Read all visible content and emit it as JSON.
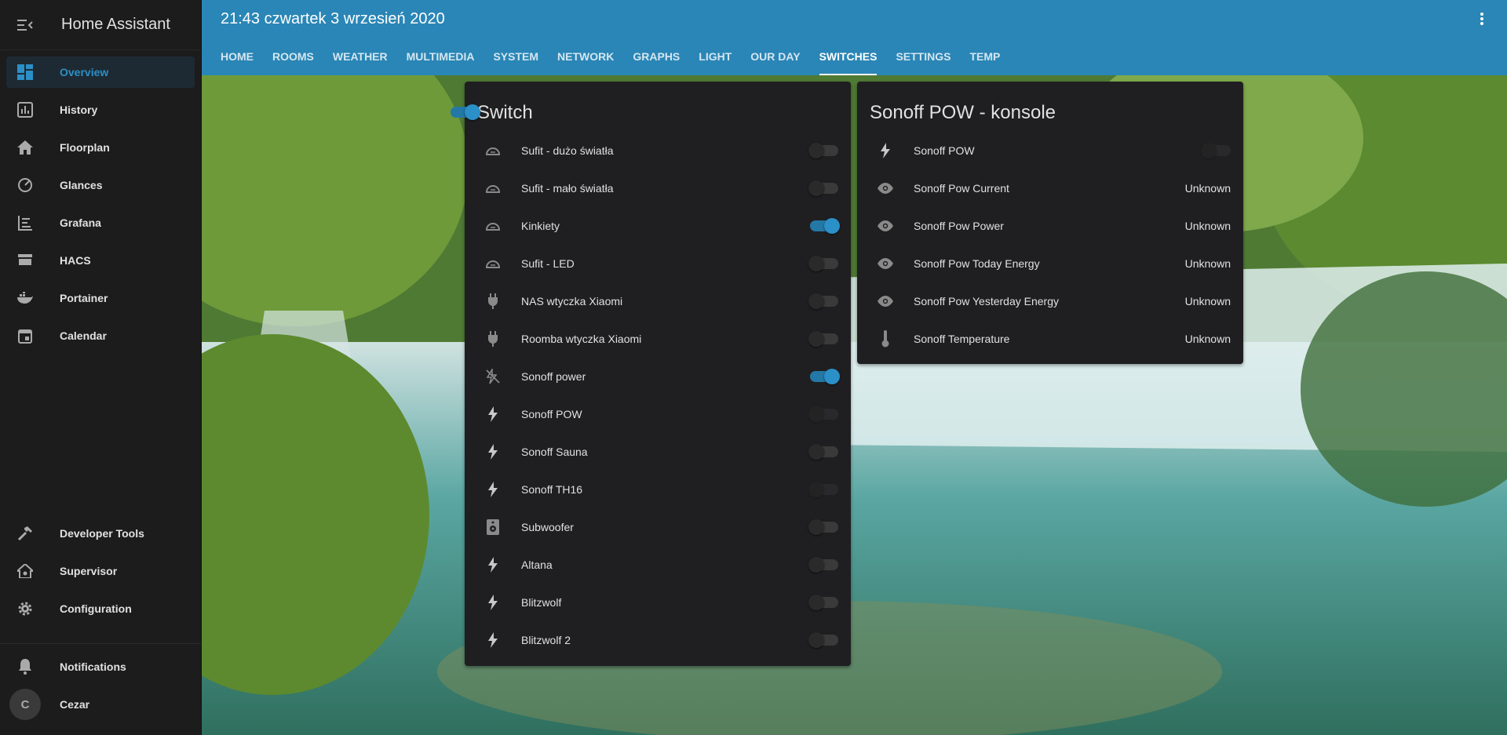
{
  "app": {
    "title": "Home Assistant"
  },
  "header": {
    "title": "21:43 czwartek 3 wrzesień 2020"
  },
  "tabs": [
    {
      "label": "HOME"
    },
    {
      "label": "ROOMS"
    },
    {
      "label": "WEATHER"
    },
    {
      "label": "MULTIMEDIA"
    },
    {
      "label": "SYSTEM"
    },
    {
      "label": "NETWORK"
    },
    {
      "label": "GRAPHS"
    },
    {
      "label": "LIGHT"
    },
    {
      "label": "OUR DAY"
    },
    {
      "label": "SWITCHES",
      "active": true
    },
    {
      "label": "SETTINGS"
    },
    {
      "label": "TEMP"
    }
  ],
  "sidebar": {
    "items": [
      {
        "label": "Overview",
        "icon": "dashboard-icon",
        "active": true
      },
      {
        "label": "History",
        "icon": "chart-icon"
      },
      {
        "label": "Floorplan",
        "icon": "home-icon"
      },
      {
        "label": "Glances",
        "icon": "speedometer-icon"
      },
      {
        "label": "Grafana",
        "icon": "chart-timeline-icon"
      },
      {
        "label": "HACS",
        "icon": "store-icon"
      },
      {
        "label": "Portainer",
        "icon": "docker-icon"
      },
      {
        "label": "Calendar",
        "icon": "calendar-icon"
      }
    ],
    "tools": [
      {
        "label": "Developer Tools",
        "icon": "hammer-icon"
      },
      {
        "label": "Supervisor",
        "icon": "home-gear-icon"
      },
      {
        "label": "Configuration",
        "icon": "cog-icon"
      }
    ],
    "notifications": "Notifications",
    "user": {
      "name": "Cezar",
      "initial": "C"
    }
  },
  "switch_card": {
    "title": "Switch",
    "header_toggle_on": true,
    "rows": [
      {
        "name": "Sufit - dużo światła",
        "icon": "ceiling-light-icon",
        "state": "off"
      },
      {
        "name": "Sufit - mało światła",
        "icon": "ceiling-light-icon",
        "state": "off"
      },
      {
        "name": "Kinkiety",
        "icon": "ceiling-light-icon",
        "state": "on"
      },
      {
        "name": "Sufit - LED",
        "icon": "ceiling-light-icon",
        "state": "off"
      },
      {
        "name": "NAS wtyczka Xiaomi",
        "icon": "power-plug-icon",
        "state": "off"
      },
      {
        "name": "Roomba wtyczka Xiaomi",
        "icon": "power-plug-icon",
        "state": "off"
      },
      {
        "name": "Sonoff power",
        "icon": "flash-off-icon",
        "state": "on"
      },
      {
        "name": "Sonoff POW",
        "icon": "flash-icon",
        "state": "unavailable"
      },
      {
        "name": "Sonoff Sauna",
        "icon": "flash-icon",
        "state": "off"
      },
      {
        "name": "Sonoff TH16",
        "icon": "flash-icon",
        "state": "unavailable"
      },
      {
        "name": "Subwoofer",
        "icon": "speaker-icon",
        "state": "off"
      },
      {
        "name": "Altana",
        "icon": "flash-icon",
        "state": "off"
      },
      {
        "name": "Blitzwolf",
        "icon": "flash-icon",
        "state": "off"
      },
      {
        "name": "Blitzwolf 2",
        "icon": "flash-icon",
        "state": "off"
      }
    ]
  },
  "pow_card": {
    "title": "Sonoff POW - konsole",
    "rows": [
      {
        "name": "Sonoff POW",
        "icon": "flash-icon",
        "toggle": "unavailable"
      },
      {
        "name": "Sonoff Pow Current",
        "icon": "eye-icon",
        "value": "Unknown"
      },
      {
        "name": "Sonoff Pow Power",
        "icon": "eye-icon",
        "value": "Unknown"
      },
      {
        "name": "Sonoff Pow Today Energy",
        "icon": "eye-icon",
        "value": "Unknown"
      },
      {
        "name": "Sonoff Pow Yesterday Energy",
        "icon": "eye-icon",
        "value": "Unknown"
      },
      {
        "name": "Sonoff Temperature",
        "icon": "thermometer-icon",
        "value": "Unknown"
      }
    ]
  },
  "colors": {
    "accent": "#2b8fc8",
    "header": "#2a86b6",
    "sidebar": "#1c1c1c",
    "card": "#1f1f21"
  }
}
